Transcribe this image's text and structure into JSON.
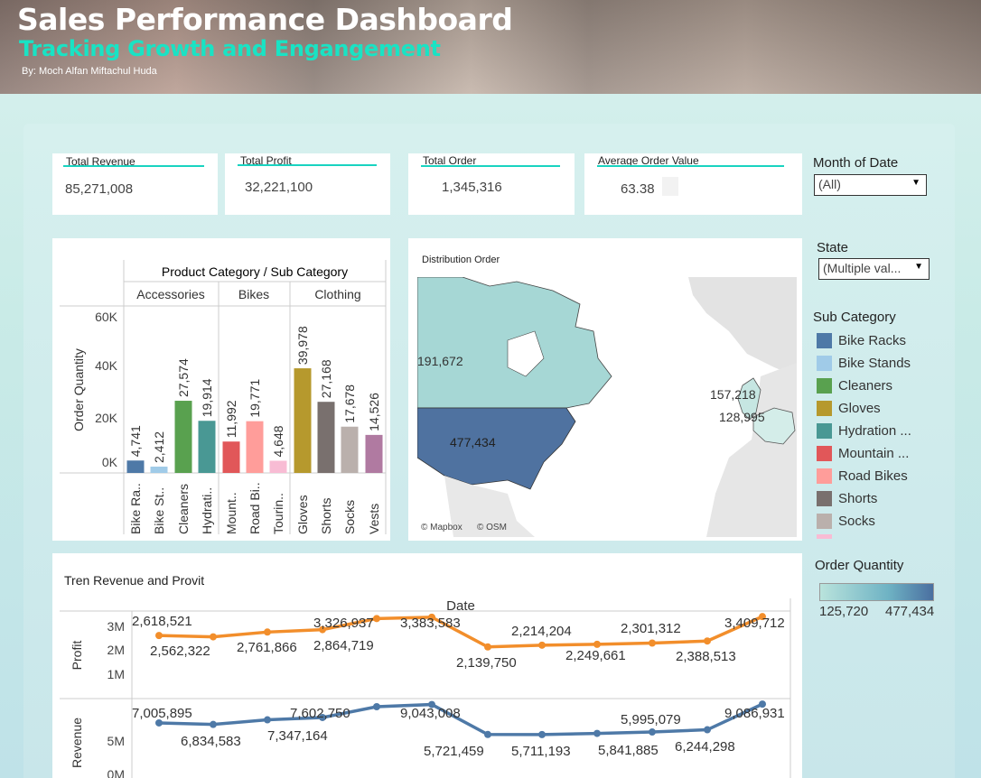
{
  "header": {
    "title": "Sales Performance Dashboard",
    "subtitle": "Tracking Growth and Engangement",
    "author": "By: Moch Alfan Miftachul Huda"
  },
  "kpis": [
    {
      "label": "Total Revenue",
      "value": "85,271,008"
    },
    {
      "label": "Total Profit",
      "value": "32,221,100"
    },
    {
      "label": "Total Order",
      "value": "1,345,316"
    },
    {
      "label": "Average Order Value",
      "value": "63.38"
    }
  ],
  "filters": {
    "month": {
      "label": "Month of Date",
      "value": "(All)"
    },
    "state": {
      "label": "State",
      "value": "(Multiple val..."
    }
  },
  "legend": {
    "title": "Sub Category",
    "items": [
      {
        "label": "Bike Racks",
        "color": "#4e79a7"
      },
      {
        "label": "Bike Stands",
        "color": "#a0cbe8"
      },
      {
        "label": "Cleaners",
        "color": "#59a14f"
      },
      {
        "label": "Gloves",
        "color": "#b6992d"
      },
      {
        "label": "Hydration ...",
        "color": "#499894"
      },
      {
        "label": "Mountain ...",
        "color": "#e15759"
      },
      {
        "label": "Road Bikes",
        "color": "#ff9d9a"
      },
      {
        "label": "Shorts",
        "color": "#79706e"
      },
      {
        "label": "Socks",
        "color": "#bab0ac"
      }
    ]
  },
  "order_quantity_legend": {
    "title": "Order Quantity",
    "min": "125,720",
    "max": "477,434",
    "color_low": "#b9e3dc",
    "color_high": "#4a6fa0"
  },
  "map": {
    "title": "Distribution Order",
    "labels": {
      "canada": "191,672",
      "usa": "477,434",
      "uk": "157,218",
      "europe": "128,995"
    },
    "attribution_1": "© Mapbox",
    "attribution_2": "© OSM"
  },
  "chart_data": [
    {
      "type": "bar",
      "title": "Product Category / Sub Category",
      "ylabel": "Order Quantity",
      "ylim": [
        0,
        60000
      ],
      "yticks": [
        "0K",
        "20K",
        "40K",
        "60K"
      ],
      "groups": [
        {
          "name": "Accessories",
          "categories": [
            "Bike Ra..",
            "Bike St..",
            "Cleaners",
            "Hydrati.."
          ]
        },
        {
          "name": "Bikes",
          "categories": [
            "Mount..",
            "Road Bi..",
            "Tourin.."
          ]
        },
        {
          "name": "Clothing",
          "categories": [
            "Gloves",
            "Shorts",
            "Socks",
            "Vests"
          ]
        }
      ],
      "values": [
        4741,
        2412,
        27574,
        19914,
        11992,
        19771,
        4648,
        39978,
        27168,
        17678,
        14526
      ],
      "value_labels": [
        "4,741",
        "2,412",
        "27,574",
        "19,914",
        "11,992",
        "19,771",
        "4,648",
        "39,978",
        "27,168",
        "17,678",
        "14,526"
      ],
      "colors": [
        "#4e79a7",
        "#a0cbe8",
        "#59a14f",
        "#499894",
        "#e15759",
        "#ff9d9a",
        "#f8bcd4",
        "#b6992d",
        "#79706e",
        "#bab0ac",
        "#b07aa1"
      ]
    },
    {
      "type": "line",
      "title": "Tren Revenue and Provit",
      "xlabel": "Date",
      "series": [
        {
          "name": "Profit",
          "color": "#f28e2b",
          "values": [
            2618521,
            2562322,
            2761866,
            2864719,
            3326937,
            3383583,
            2139750,
            2214204,
            2249661,
            2301312,
            2388513,
            3409712
          ],
          "labels": [
            "2,618,521",
            "2,562,322",
            "2,761,866",
            "2,864,719",
            "3,326,937",
            "3,383,583",
            "2,139,750",
            "2,214,204",
            "2,249,661",
            "2,301,312",
            "2,388,513",
            "3,409,712"
          ],
          "yticks": [
            "1M",
            "2M",
            "3M"
          ]
        },
        {
          "name": "Revenue",
          "color": "#4e79a7",
          "values": [
            7005895,
            6834583,
            7347164,
            7602750,
            8800000,
            9043008,
            5721459,
            5711193,
            5841885,
            5995079,
            6244298,
            9086931
          ],
          "labels": [
            "7,005,895",
            "6,834,583",
            "7,347,164",
            "7,602,750",
            "",
            "9,043,008",
            "5,721,459",
            "5,711,193",
            "5,841,885",
            "5,995,079",
            "6,244,298",
            "9,086,931"
          ],
          "yticks": [
            "0M",
            "5M"
          ]
        }
      ]
    }
  ]
}
